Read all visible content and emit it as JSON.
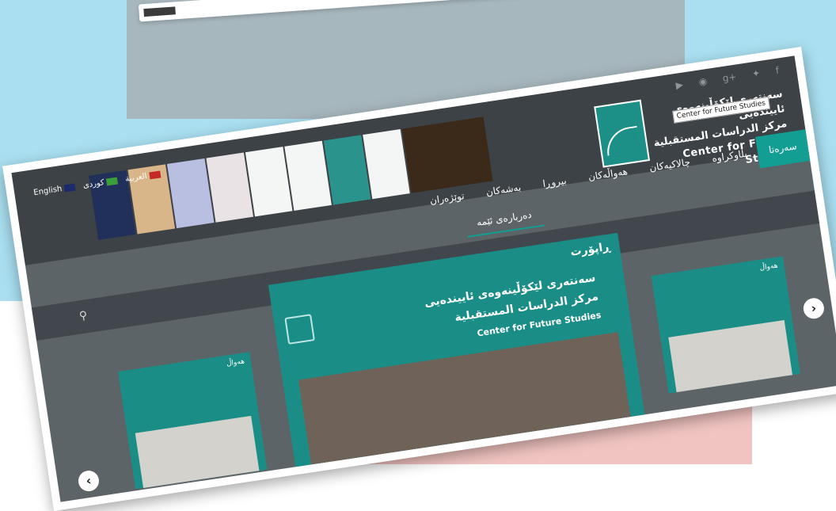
{
  "social": {
    "icons": [
      "youtube-icon",
      "rss-icon",
      "google-plus-icon",
      "twitter-icon",
      "facebook-icon"
    ]
  },
  "header": {
    "org_ku": "سەنتەری لێکۆڵینەوەی ئاییندەیی",
    "org_ar": "مركز الدراسات المستقبلية",
    "org_en": "Center for Future Studies",
    "tooltip": "Center for Future Studies"
  },
  "languages": [
    {
      "label": "English",
      "flag_color": "#1b2a6b"
    },
    {
      "label": "كوردی",
      "flag_color": "#3a9e3a"
    },
    {
      "label": "العربية",
      "flag_color": "#c62828"
    }
  ],
  "nav": {
    "items": [
      "سەرەتا",
      "بڵاوکراوە",
      "چالاکیەکان",
      "هەواڵەکان",
      "بیروڕا",
      "بەشەکان",
      "توێژەران",
      "دەربارەی ئێمە"
    ],
    "active_index": 0
  },
  "subnav": {
    "items": [
      "دەربارەی ئێمە"
    ]
  },
  "search": {
    "icon": "search-icon"
  },
  "featured": {
    "section_title": "ڕاپۆرت",
    "org_ku": "سەنتەری لێکۆڵینەوەی ئاییندەیی",
    "org_ar": "مركز الدراسات المستقبلية",
    "org_en": "Center for Future Studies"
  },
  "side_right": {
    "caption": "هەواڵ"
  },
  "side_left": {
    "caption": "هەواڵ"
  },
  "colors": {
    "accent": "#139e94",
    "header": "#3d4247",
    "body": "#5c6468"
  }
}
